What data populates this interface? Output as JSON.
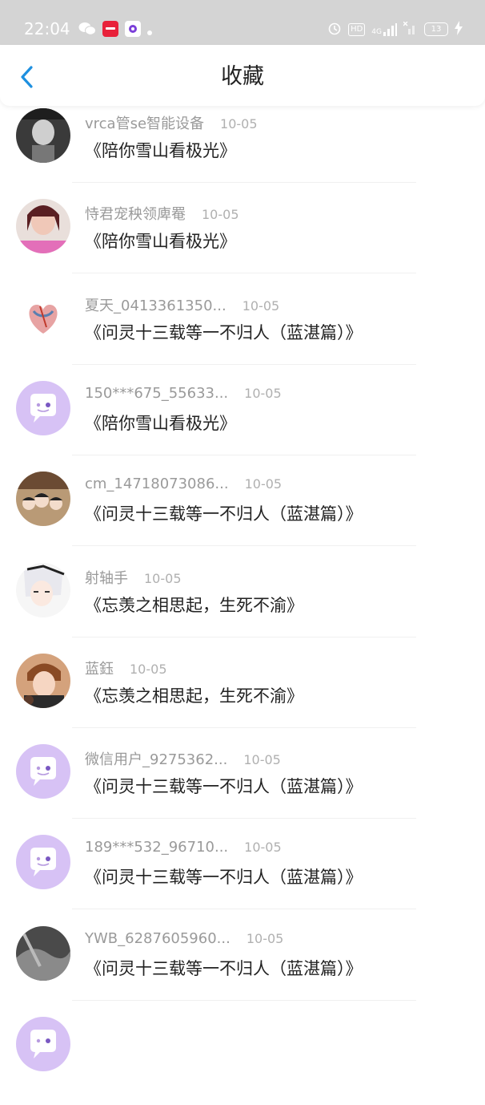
{
  "status_bar": {
    "time": "22:04",
    "network": "4G",
    "hd_label": "HD",
    "battery": "13",
    "left_icons": [
      "wechat-icon",
      "xiaohongshu-icon",
      "app-icon",
      "dot-icon"
    ],
    "right_icons": [
      "alarm-icon",
      "hd-icon",
      "signal-icon",
      "no-signal-icon",
      "battery-icon",
      "charging-icon"
    ]
  },
  "header": {
    "title": "收藏",
    "back_icon": "chevron-left-icon",
    "accent": "#1e90e0"
  },
  "list": {
    "items": [
      {
        "user": "vrca管se智能设备",
        "date": "10-05",
        "title": "《陪你雪山看极光》",
        "avatar": "photo-dark"
      },
      {
        "user": "恃君宠秧领庳罨",
        "date": "10-05",
        "title": "《陪你雪山看极光》",
        "avatar": "photo-girl"
      },
      {
        "user": "夏天_0413361350...",
        "date": "10-05",
        "title": "《问灵十三载等一不归人（蓝湛篇）》",
        "avatar": "photo-heart"
      },
      {
        "user": "150***675_55633...",
        "date": "10-05",
        "title": "《陪你雪山看极光》",
        "avatar": "default-chat"
      },
      {
        "user": "cm_14718073086...",
        "date": "10-05",
        "title": "《问灵十三载等一不归人（蓝湛篇）》",
        "avatar": "photo-cartoon-group"
      },
      {
        "user": "射轴手",
        "date": "10-05",
        "title": "《忘羡之相思起，生死不渝》",
        "avatar": "photo-anime-white"
      },
      {
        "user": "蓝鈺",
        "date": "10-05",
        "title": "《忘羡之相思起，生死不渝》",
        "avatar": "photo-anime-boy"
      },
      {
        "user": "微信用户_9275362...",
        "date": "10-05",
        "title": "《问灵十三载等一不归人（蓝湛篇）》",
        "avatar": "default-chat"
      },
      {
        "user": "189***532_96710...",
        "date": "10-05",
        "title": "《问灵十三载等一不归人（蓝湛篇）》",
        "avatar": "default-chat"
      },
      {
        "user": "YWB_6287605960...",
        "date": "10-05",
        "title": "《问灵十三载等一不归人（蓝湛篇）》",
        "avatar": "photo-dark-gray"
      },
      {
        "user": "",
        "date": "",
        "title": "",
        "avatar": "default-chat"
      }
    ]
  },
  "colors": {
    "default_avatar": "#d7c2f5",
    "text_primary": "#222222",
    "text_secondary": "#9a9a9a"
  }
}
